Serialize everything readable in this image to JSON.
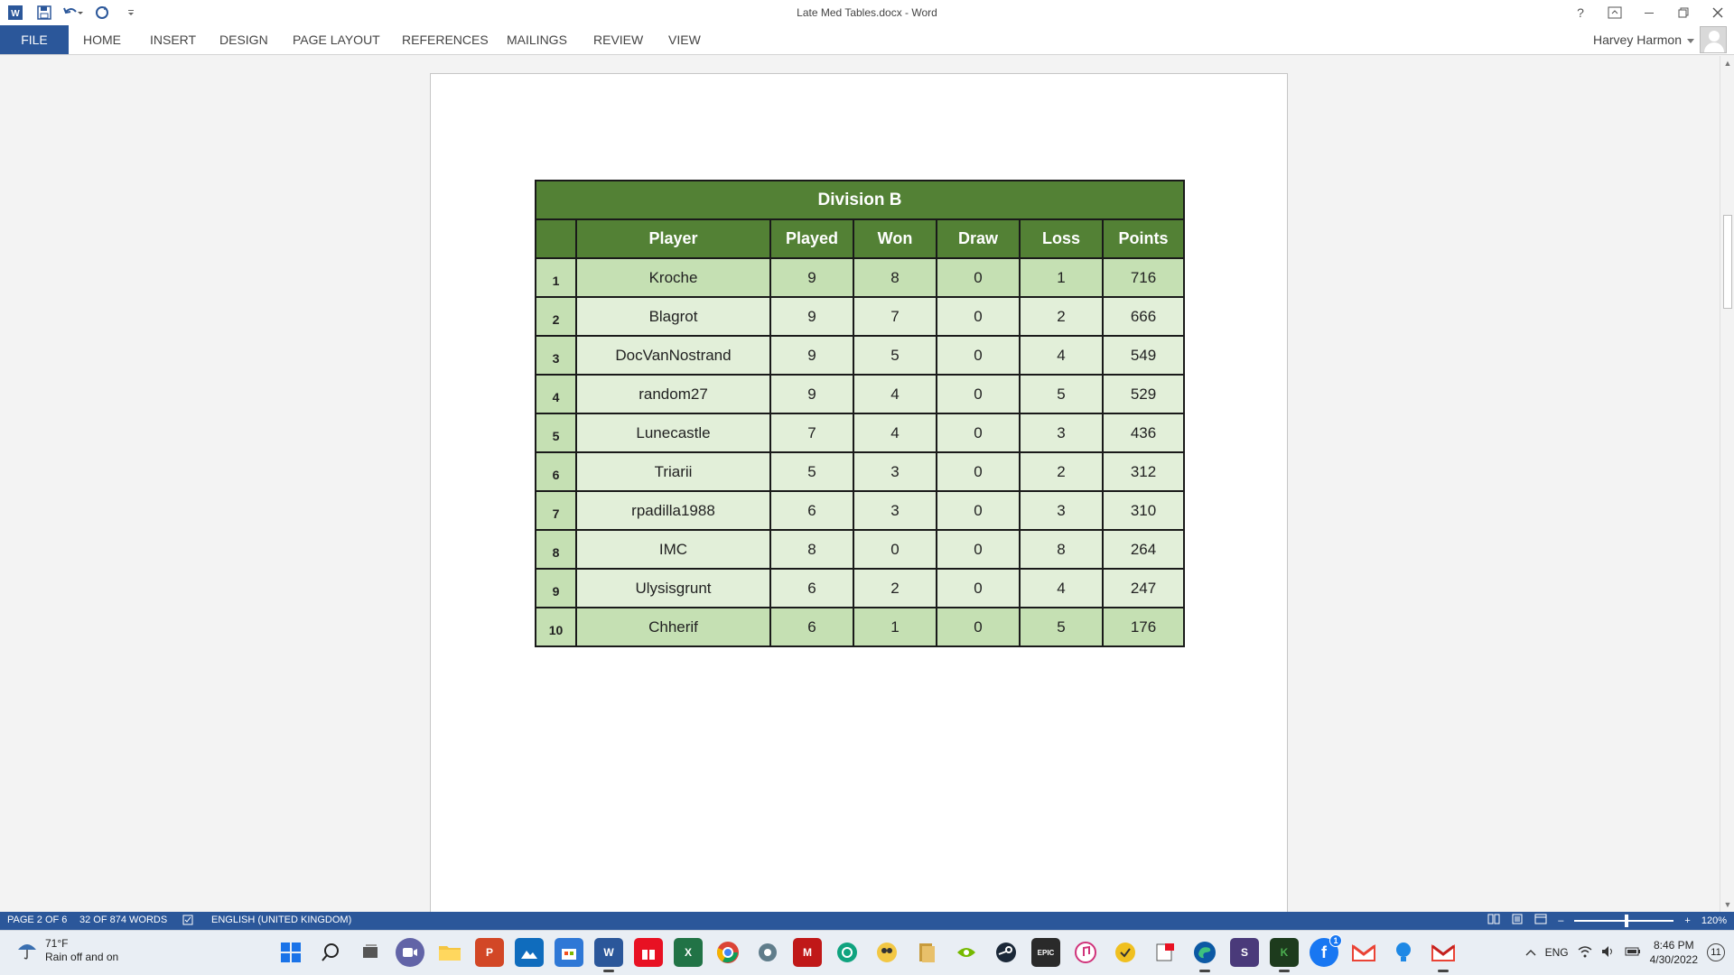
{
  "window": {
    "title": "Late Med Tables.docx - Word",
    "help_label": "?",
    "user_name": "Harvey Harmon"
  },
  "ribbon": {
    "tabs": [
      "FILE",
      "HOME",
      "INSERT",
      "DESIGN",
      "PAGE LAYOUT",
      "REFERENCES",
      "MAILINGS",
      "REVIEW",
      "VIEW"
    ]
  },
  "table": {
    "division_title": "Division B",
    "headers": [
      "",
      "Player",
      "Played",
      "Won",
      "Draw",
      "Loss",
      "Points"
    ],
    "rows": [
      {
        "rank": "1",
        "player": "Kroche",
        "played": "9",
        "won": "8",
        "draw": "0",
        "loss": "1",
        "points": "716"
      },
      {
        "rank": "2",
        "player": "Blagrot",
        "played": "9",
        "won": "7",
        "draw": "0",
        "loss": "2",
        "points": "666"
      },
      {
        "rank": "3",
        "player": "DocVanNostrand",
        "played": "9",
        "won": "5",
        "draw": "0",
        "loss": "4",
        "points": "549"
      },
      {
        "rank": "4",
        "player": "random27",
        "played": "9",
        "won": "4",
        "draw": "0",
        "loss": "5",
        "points": "529"
      },
      {
        "rank": "5",
        "player": "Lunecastle",
        "played": "7",
        "won": "4",
        "draw": "0",
        "loss": "3",
        "points": "436"
      },
      {
        "rank": "6",
        "player": "Triarii",
        "played": "5",
        "won": "3",
        "draw": "0",
        "loss": "2",
        "points": "312"
      },
      {
        "rank": "7",
        "player": "rpadilla1988",
        "played": "6",
        "won": "3",
        "draw": "0",
        "loss": "3",
        "points": "310"
      },
      {
        "rank": "8",
        "player": "IMC",
        "played": "8",
        "won": "0",
        "draw": "0",
        "loss": "8",
        "points": "264"
      },
      {
        "rank": "9",
        "player": "Ulysisgrunt",
        "played": "6",
        "won": "2",
        "draw": "0",
        "loss": "4",
        "points": "247"
      },
      {
        "rank": "10",
        "player": "Chherif",
        "played": "6",
        "won": "1",
        "draw": "0",
        "loss": "5",
        "points": "176"
      }
    ]
  },
  "status": {
    "page": "PAGE 2 OF 6",
    "words": "32 OF 874 WORDS",
    "language": "ENGLISH (UNITED KINGDOM)",
    "zoom": "120%",
    "zoom_level_percent": 120
  },
  "taskbar": {
    "weather_temp": "71°F",
    "weather_desc": "Rain off and on",
    "lang": "ENG",
    "time": "8:46 PM",
    "date": "4/30/2022",
    "notifications": "11",
    "facebook_badge": "1",
    "apps": [
      "windows-start",
      "search",
      "task-view",
      "teams-chat",
      "file-explorer",
      "powerpoint",
      "photos",
      "store",
      "word",
      "gift",
      "excel",
      "chrome",
      "settings",
      "mcafee",
      "chatgpt",
      "cool-app",
      "files",
      "nvidia",
      "steam",
      "epic-games",
      "itunes",
      "todo",
      "snip",
      "edge",
      "stack",
      "kindle",
      "facebook",
      "gmail",
      "keep",
      "gmail-2"
    ],
    "app_labels": {
      "powerpoint": "P",
      "word": "W",
      "excel": "X",
      "mcafee": "M",
      "epic": "EPIC",
      "stack": "S",
      "kindle": "K",
      "gmail": "M"
    }
  },
  "colors": {
    "word_blue": "#2b579a",
    "table_header_green": "#538135",
    "table_row_light": "#e2efd9",
    "table_row_mid": "#c5e0b3"
  }
}
